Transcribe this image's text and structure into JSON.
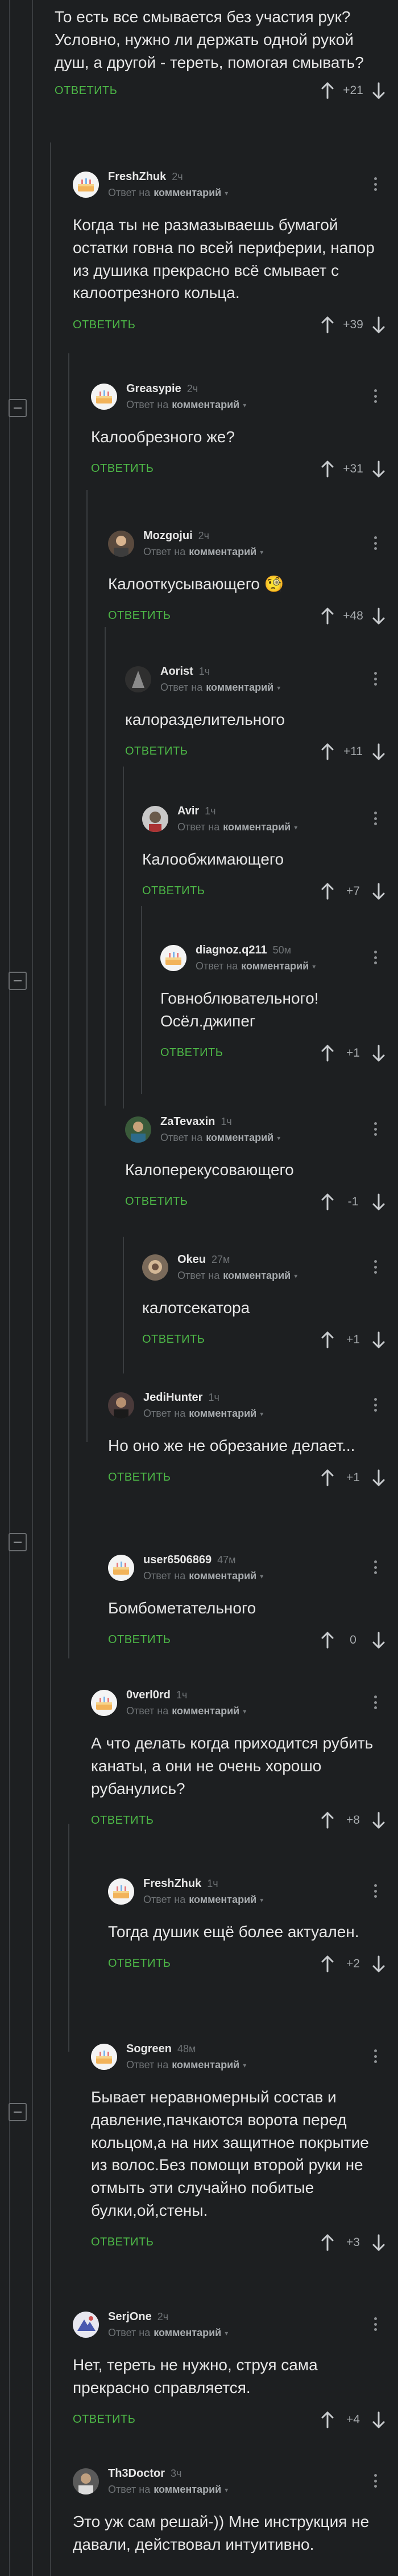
{
  "reply_prefix": "Ответ на",
  "reply_target": "комментарий",
  "reply_button": "ОТВЕТИТЬ",
  "colors": {
    "background": "#1d1f21",
    "text": "#e6e6e6",
    "accent_green": "#4db847",
    "muted": "#6f7376",
    "tree_line": "#3a3d40"
  },
  "comments": [
    {
      "text": "То есть все смывается без участия рук? Условно, нужно ли держать одной рукой душ, а другой - тереть, помогая смывать?",
      "score": "+21"
    },
    {
      "nick": "FreshZhuk",
      "time": "2ч",
      "text": "Когда ты не размазываешь бумагой остатки говна по всей периферии, напор из душика прекрасно всё смывает с калоотрезного кольца.",
      "score": "+39",
      "avatar": "cake-icon"
    },
    {
      "nick": "Greasypie",
      "time": "2ч",
      "text": "Калообрезного же?",
      "score": "+31",
      "avatar": "cake-icon"
    },
    {
      "nick": "Mozgojui",
      "time": "2ч",
      "text": "Калооткусывающего 🧐",
      "score": "+48",
      "avatar": "user-photo"
    },
    {
      "nick": "Aorist",
      "time": "1ч",
      "text": "калоразделительного",
      "score": "+11",
      "avatar": "user-photo"
    },
    {
      "nick": "Avir",
      "time": "1ч",
      "text": "Калообжимающего",
      "score": "+7",
      "avatar": "user-photo"
    },
    {
      "nick": "diagnoz.q211",
      "time": "50м",
      "text": "Говнобл​ювательного!\nОсёл.джипег",
      "score": "+1",
      "avatar": "cake-icon"
    },
    {
      "nick": "ZaTevaxin",
      "time": "1ч",
      "text": "Калоперекусовающего",
      "score": "-1",
      "avatar": "user-photo"
    },
    {
      "nick": "Okeu",
      "time": "27м",
      "text": "калотсекатора",
      "score": "+1",
      "avatar": "user-photo"
    },
    {
      "nick": "JediHunter",
      "time": "1ч",
      "text": "Но оно же не обрезание делает...",
      "score": "+1",
      "avatar": "user-photo"
    },
    {
      "nick": "user6506869",
      "time": "47м",
      "text": "Бомбометательного",
      "score": "0",
      "avatar": "cake-icon"
    },
    {
      "nick": "0verl0rd",
      "time": "1ч",
      "text": "А что делать когда приходится рубить канаты, а они не очень хорошо рубанулись?",
      "score": "+8",
      "avatar": "cake-icon"
    },
    {
      "nick": "FreshZhuk",
      "time": "1ч",
      "text": "Тогда душик ещё более актуален.",
      "score": "+2",
      "avatar": "cake-icon"
    },
    {
      "nick": "Sogreen",
      "time": "48м",
      "text": "Бывает неравномерный состав и давление,пачкаются ворота перед кольцом,а на них защитное покрытие из волос.Без помощи второй руки не отмыть эти случайно побитые булки,ой,стены.",
      "score": "+3",
      "avatar": "cake-icon"
    },
    {
      "nick": "SerjOne",
      "time": "2ч",
      "text": "Нет, тереть не нужно, струя сама прекрасно справляется.",
      "score": "+4",
      "avatar": "user-photo"
    },
    {
      "nick": "Th3Doctor",
      "time": "3ч",
      "text": "Это уж сам решай-)) Мне инструкция не давали, действовал интуитивно.",
      "avatar": "user-photo"
    }
  ]
}
